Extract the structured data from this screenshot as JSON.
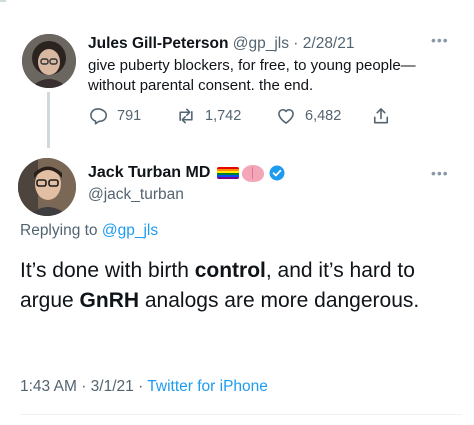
{
  "parent_tweet": {
    "name": "Jules Gill-Peterson",
    "handle": "@gp_jls",
    "separator": "·",
    "date": "2/28/21",
    "text": "give puberty blockers, for free, to young people—without parental consent. the end.",
    "stats": {
      "replies": "791",
      "retweets": "1,742",
      "likes": "6,482"
    }
  },
  "main_tweet": {
    "name": "Jack Turban MD",
    "handle": "@jack_turban",
    "replying_prefix": "Replying to",
    "replying_to": "@gp_jls",
    "text_parts": [
      "It’s done with birth ",
      "control",
      ", and it’s hard to argue ",
      "GnRH",
      " analogs are more dangerous."
    ],
    "time": "1:43 AM",
    "separator": "·",
    "date": "3/1/21",
    "separator2": "·",
    "source": "Twitter for iPhone"
  },
  "icons": {
    "more": "more-dots-icon",
    "reply": "reply-icon",
    "retweet": "retweet-icon",
    "like": "heart-icon",
    "share": "share-icon",
    "flag": "rainbow-flag-icon",
    "brain": "brain-icon",
    "verified": "verified-badge-icon"
  },
  "colors": {
    "accent": "#1d9bf0",
    "muted": "#536471",
    "text": "#0f1419"
  }
}
